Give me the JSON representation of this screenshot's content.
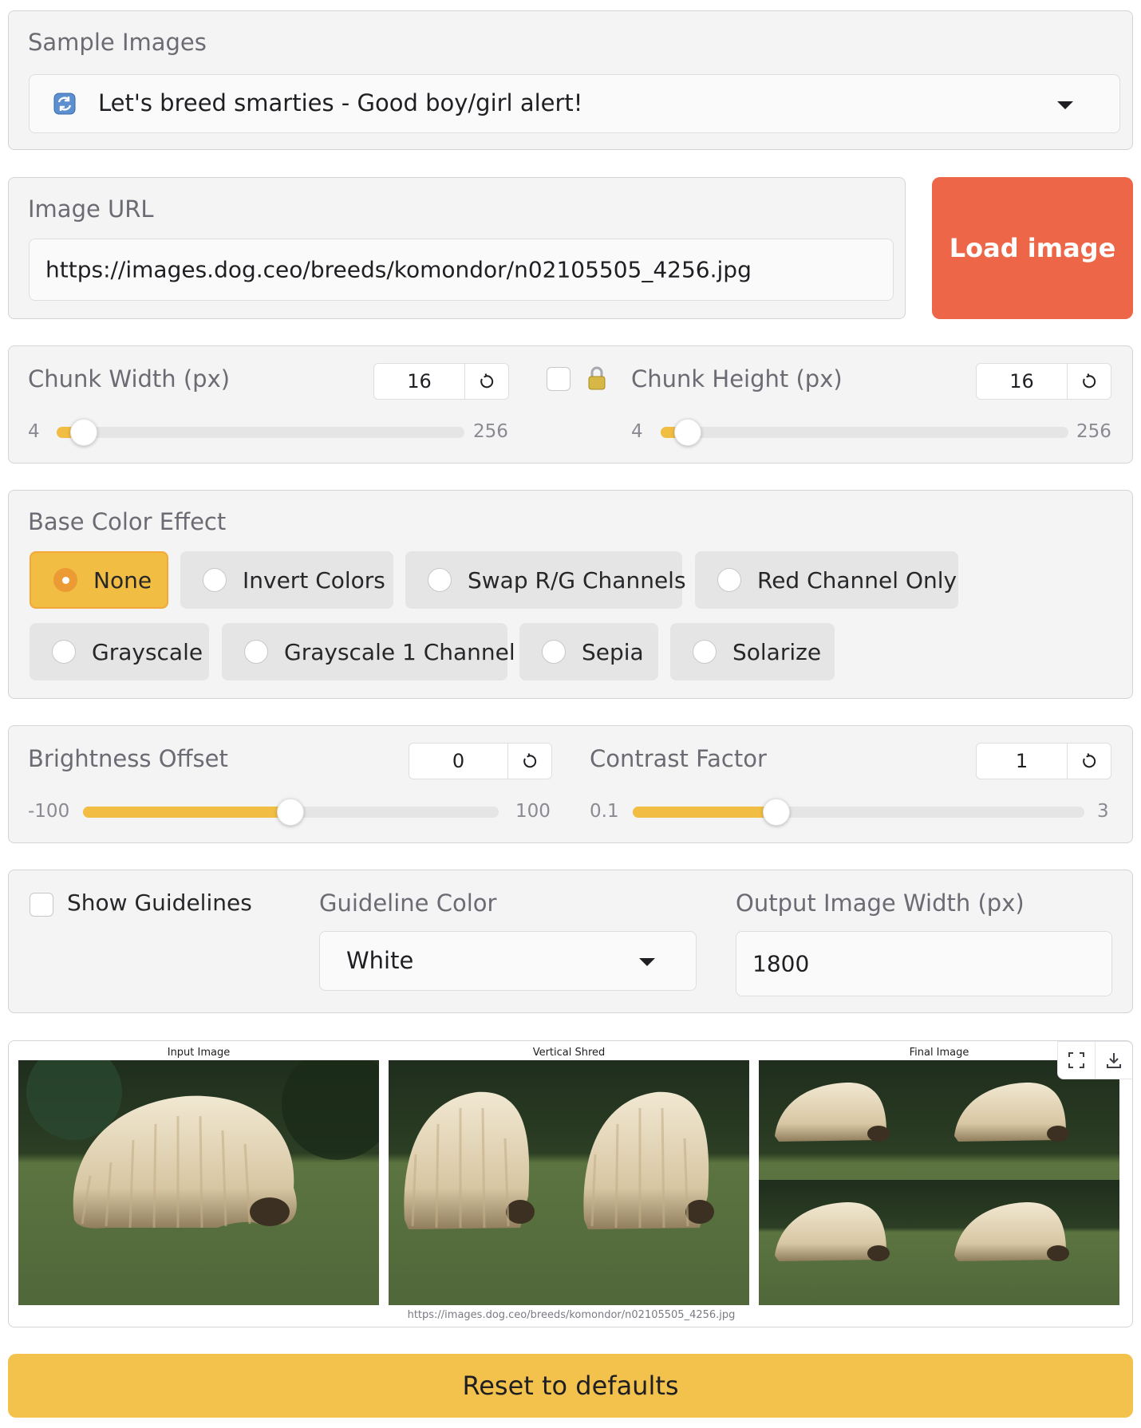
{
  "sample_images": {
    "label": "Sample Images",
    "icon": "refresh-icon",
    "selected": "Let's breed smarties - Good boy/girl alert!"
  },
  "image_url": {
    "label": "Image URL",
    "value": "https://images.dog.ceo/breeds/komondor/n02105505_4256.jpg"
  },
  "load_button": {
    "label": "Load image",
    "color": "#ec6647"
  },
  "chunk_width": {
    "label": "Chunk Width (px)",
    "value": "16",
    "min": "4",
    "max": "256",
    "level": 0.047
  },
  "chunk_height": {
    "label": "Chunk Height (px)",
    "value": "16",
    "min": "4",
    "max": "256",
    "level": 0.047
  },
  "lock_icon": "lock-icon",
  "base_color_effect": {
    "label": "Base Color Effect",
    "selected": "None",
    "options": [
      "None",
      "Invert Colors",
      "Swap R/G Channels",
      "Red Channel Only",
      "Grayscale",
      "Grayscale 1 Channel",
      "Sepia",
      "Solarize"
    ]
  },
  "brightness": {
    "label": "Brightness Offset",
    "value": "0",
    "min": "-100",
    "max": "100",
    "level": 0.5
  },
  "contrast": {
    "label": "Contrast Factor",
    "value": "1",
    "min": "0.1",
    "max": "3",
    "level": 0.31
  },
  "guidelines": {
    "label": "Show Guidelines",
    "checked": false
  },
  "guideline_color": {
    "label": "Guideline Color",
    "selected": "White"
  },
  "output_width": {
    "label": "Output Image Width (px)",
    "value": "1800"
  },
  "gallery": {
    "titles": [
      "Input Image",
      "Vertical Shred",
      "Final Image"
    ],
    "caption": "https://images.dog.ceo/breeds/komondor/n02105505_4256.jpg",
    "actions": [
      "fullscreen-icon",
      "download-icon"
    ]
  },
  "reset_button": {
    "label": "Reset to defaults",
    "color": "#f2c24d"
  },
  "accent_color": "#f1bd43"
}
